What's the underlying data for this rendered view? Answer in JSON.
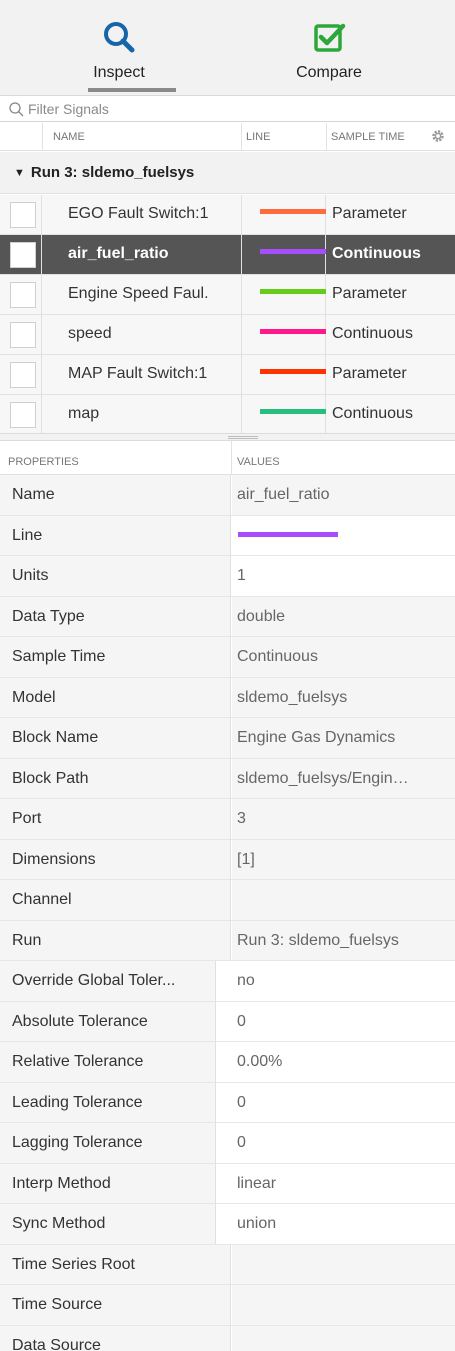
{
  "tabs": [
    {
      "label": "Inspect",
      "icon": "magnifier-icon",
      "active": true
    },
    {
      "label": "Compare",
      "icon": "checkbox-icon",
      "active": false
    }
  ],
  "filter": {
    "placeholder": "Filter Signals",
    "value": ""
  },
  "signal_table": {
    "columns": {
      "name": "NAME",
      "line": "LINE",
      "sample_time": "SAMPLE TIME"
    },
    "run_label": "Run 3: sldemo_fuelsys",
    "rows": [
      {
        "name": "EGO Fault Switch:1",
        "color": "#ff6b3d",
        "sample_time": "Parameter",
        "selected": false
      },
      {
        "name": "air_fuel_ratio",
        "color": "#a64dff",
        "sample_time": "Continuous",
        "selected": true
      },
      {
        "name": "Engine Speed Faul.",
        "color": "#66cc1a",
        "sample_time": "Parameter",
        "selected": false
      },
      {
        "name": "speed",
        "color": "#ff1a8c",
        "sample_time": "Continuous",
        "selected": false
      },
      {
        "name": "MAP Fault Switch:1",
        "color": "#ff3300",
        "sample_time": "Parameter",
        "selected": false
      },
      {
        "name": "map",
        "color": "#26bf80",
        "sample_time": "Continuous",
        "selected": false
      }
    ]
  },
  "properties": {
    "header_properties": "PROPERTIES",
    "header_values": "VALUES",
    "line_color": "#a64dff",
    "rows": [
      {
        "key": "Name",
        "value": "air_fuel_ratio"
      },
      {
        "key": "Line",
        "value": ""
      },
      {
        "key": "Units",
        "value": "1"
      },
      {
        "key": "Data Type",
        "value": "double"
      },
      {
        "key": "Sample Time",
        "value": "Continuous"
      },
      {
        "key": "Model",
        "value": "sldemo_fuelsys"
      },
      {
        "key": "Block Name",
        "value": "Engine Gas Dynamics"
      },
      {
        "key": "Block Path",
        "value": "sldemo_fuelsys/Engin…"
      },
      {
        "key": "Port",
        "value": "3"
      },
      {
        "key": "Dimensions",
        "value": "[1]"
      },
      {
        "key": "Channel",
        "value": ""
      },
      {
        "key": "Run",
        "value": "Run 3: sldemo_fuelsys"
      },
      {
        "key": "Override Global Toler...",
        "value": "no"
      },
      {
        "key": "Absolute Tolerance",
        "value": "0"
      },
      {
        "key": "Relative Tolerance",
        "value": "0.00%"
      },
      {
        "key": "Leading Tolerance",
        "value": "0"
      },
      {
        "key": "Lagging Tolerance",
        "value": "0"
      },
      {
        "key": "Interp Method",
        "value": "linear"
      },
      {
        "key": "Sync Method",
        "value": "union"
      },
      {
        "key": "Time Series Root",
        "value": ""
      },
      {
        "key": "Time Source",
        "value": ""
      },
      {
        "key": "Data Source",
        "value": ""
      }
    ]
  }
}
